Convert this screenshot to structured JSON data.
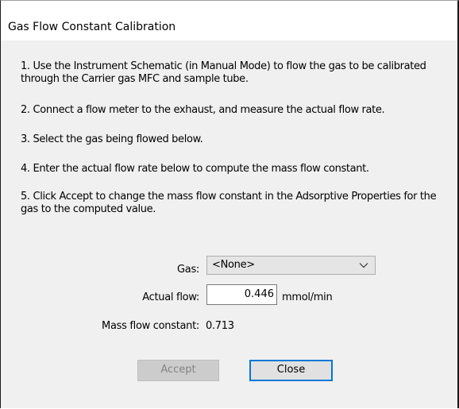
{
  "dialog": {
    "title": "Gas Flow Constant Calibration"
  },
  "instructions": {
    "step1": "1. Use the Instrument Schematic (in Manual Mode) to flow the gas to be calibrated through the Carrier gas MFC and sample tube.",
    "step2": "2. Connect a flow meter to the exhaust, and measure the actual flow rate.",
    "step3": "3. Select the gas being flowed below.",
    "step4": "4. Enter the actual flow rate below to compute the mass flow constant.",
    "step5": "5. Click Accept to change the mass flow constant in the Adsorptive Properties for the gas to the computed value."
  },
  "form": {
    "gas_label": "Gas:",
    "gas_value": "<None>",
    "actual_flow_label": "Actual flow:",
    "actual_flow_value": "0.446",
    "actual_flow_unit": "mmol/min",
    "mass_flow_constant_label": "Mass flow constant:",
    "mass_flow_constant_value": "0.713"
  },
  "buttons": {
    "accept_label": "Accept",
    "accept_enabled": false,
    "close_label": "Close"
  },
  "icons": {
    "dropdown": "chevron-down-icon"
  },
  "colors": {
    "dialog_background": "#f0f0f0",
    "title_background": "#ffffff",
    "focus_border": "#0078d7",
    "disabled_text": "#838383"
  }
}
